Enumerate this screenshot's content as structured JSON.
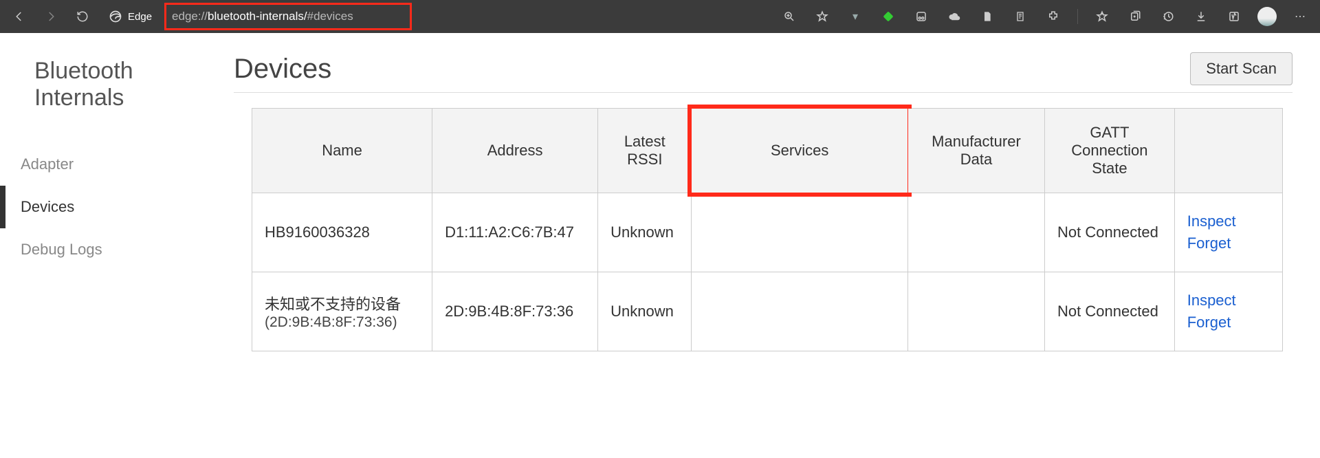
{
  "browser": {
    "brand": "Edge",
    "url_prefix": "edge://",
    "url_mid": "bluetooth-internals/",
    "url_suffix": "#devices"
  },
  "sidebar": {
    "title_line1": "Bluetooth",
    "title_line2": "Internals",
    "items": [
      {
        "label": "Adapter",
        "active": false
      },
      {
        "label": "Devices",
        "active": true
      },
      {
        "label": "Debug Logs",
        "active": false
      }
    ]
  },
  "main": {
    "heading": "Devices",
    "scan_button": "Start Scan"
  },
  "columns": {
    "name": "Name",
    "address": "Address",
    "rssi": "Latest RSSI",
    "services": "Services",
    "mfr": "Manufacturer Data",
    "gatt": "GATT Connection State",
    "actions": ""
  },
  "actions": {
    "inspect": "Inspect",
    "forget": "Forget"
  },
  "devices": [
    {
      "name": "HB9160036328",
      "name_sub": "",
      "address": "D1:11:A2:C6:7B:47",
      "rssi": "Unknown",
      "services": "",
      "mfr": "",
      "gatt": "Not Connected"
    },
    {
      "name": "未知或不支持的设备",
      "name_sub": "(2D:9B:4B:8F:73:36)",
      "address": "2D:9B:4B:8F:73:36",
      "rssi": "Unknown",
      "services": "",
      "mfr": "",
      "gatt": "Not Connected"
    }
  ]
}
